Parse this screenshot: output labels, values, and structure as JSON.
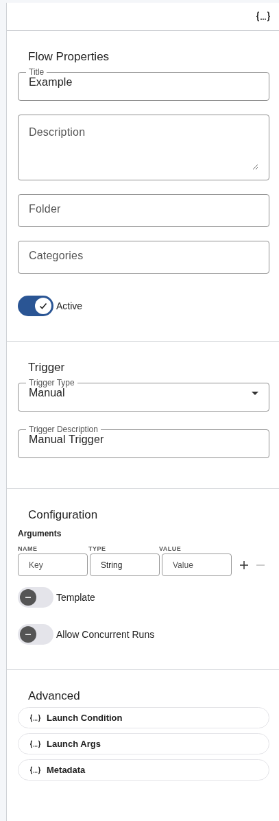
{
  "sections": [
    {
      "title": "Flow Properties",
      "items": [
        {
          "kind": "field",
          "label": "Title",
          "value": "Example"
        },
        {
          "kind": "textarea",
          "placeholder": "Description"
        },
        {
          "kind": "field",
          "placeholder": "Folder"
        },
        {
          "kind": "field",
          "placeholder": "Categories"
        },
        {
          "kind": "switch",
          "label": "Active",
          "checked": true
        }
      ]
    },
    {
      "title": "Trigger",
      "items": [
        {
          "kind": "select",
          "label": "Trigger Type",
          "value": "Manual"
        },
        {
          "kind": "field",
          "label": "Trigger Description",
          "value": "Manual Trigger"
        }
      ]
    },
    {
      "title": "Configuration",
      "items": [
        {
          "kind": "arguments",
          "label": "Arguments",
          "columns": [
            "NAME",
            "TYPE",
            "VALUE"
          ],
          "name_placeholder": "Key",
          "type_value": "String",
          "value_placeholder": "Value",
          "remove_disabled": true
        },
        {
          "kind": "switch",
          "label": "Template",
          "checked": false
        },
        {
          "kind": "switch",
          "label": "Allow Concurrent Runs",
          "checked": false
        }
      ]
    },
    {
      "title": "Advanced",
      "items": [
        {
          "kind": "code_button",
          "label": "Launch Condition"
        },
        {
          "kind": "code_button",
          "label": "Launch Args"
        },
        {
          "kind": "code_button",
          "label": "Metadata"
        }
      ]
    }
  ]
}
